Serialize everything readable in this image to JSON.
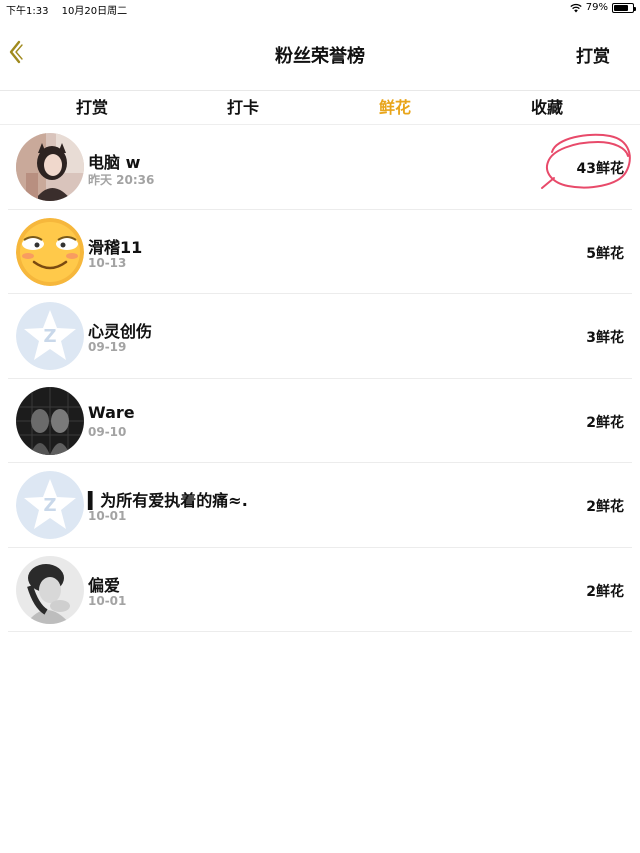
{
  "status_bar": {
    "time": "下午1:33",
    "date": "10月20日周二",
    "battery": "79%",
    "battery_level": 0.79
  },
  "nav": {
    "title": "粉丝荣誉榜",
    "right_action": "打赏",
    "back_icon": "chevron-left-icon",
    "accent": "#e8a51b"
  },
  "tabs": [
    {
      "label": "打赏",
      "active": false
    },
    {
      "label": "打卡",
      "active": false
    },
    {
      "label": "鲜花",
      "active": true
    },
    {
      "label": "收藏",
      "active": false
    }
  ],
  "fans": [
    {
      "name": "电脑 w",
      "time": "昨天 20:36",
      "count": "43鲜花",
      "avatar": "girl-photo"
    },
    {
      "name": "滑稽11",
      "time": "10-13",
      "count": "5鲜花",
      "avatar": "smiley-face"
    },
    {
      "name": "心灵创伤",
      "time": "09-19",
      "count": "3鲜花",
      "avatar": "default-qq-avatar"
    },
    {
      "name": "Ware",
      "time": "09-10",
      "count": "2鲜花",
      "avatar": "dark-photo"
    },
    {
      "name": "▍为所有爱执着的痛≈.",
      "time": "10-01",
      "count": "2鲜花",
      "avatar": "default-qq-avatar"
    },
    {
      "name": "偏爱",
      "time": "10-01",
      "count": "2鲜花",
      "avatar": "bw-photo"
    }
  ],
  "colors": {
    "active_tab": "#e8a51b",
    "annotation_circle": "#e84a6a",
    "timestamp": "#a3a3a3"
  }
}
